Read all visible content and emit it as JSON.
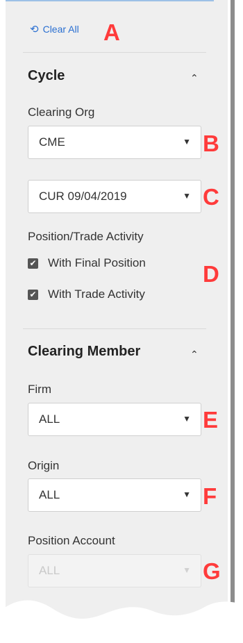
{
  "clear_all": {
    "label": "Clear All",
    "icon": "undo-icon"
  },
  "cycle": {
    "title": "Cycle",
    "clearing_org": {
      "label": "Clearing Org",
      "value": "CME"
    },
    "cycle_date": {
      "value": "CUR 09/04/2019"
    },
    "activity": {
      "label": "Position/Trade Activity",
      "options": [
        {
          "label": "With Final Position",
          "checked": true
        },
        {
          "label": "With Trade Activity",
          "checked": true
        }
      ]
    }
  },
  "clearing_member": {
    "title": "Clearing Member",
    "firm": {
      "label": "Firm",
      "value": "ALL"
    },
    "origin": {
      "label": "Origin",
      "value": "ALL"
    },
    "position_account": {
      "label": "Position Account",
      "value": "ALL",
      "disabled": true
    }
  },
  "markers": [
    "A",
    "B",
    "C",
    "D",
    "E",
    "F",
    "G"
  ],
  "colors": {
    "accent": "#2a6fd1",
    "marker": "#ff3b3b",
    "panel": "#efefef"
  }
}
